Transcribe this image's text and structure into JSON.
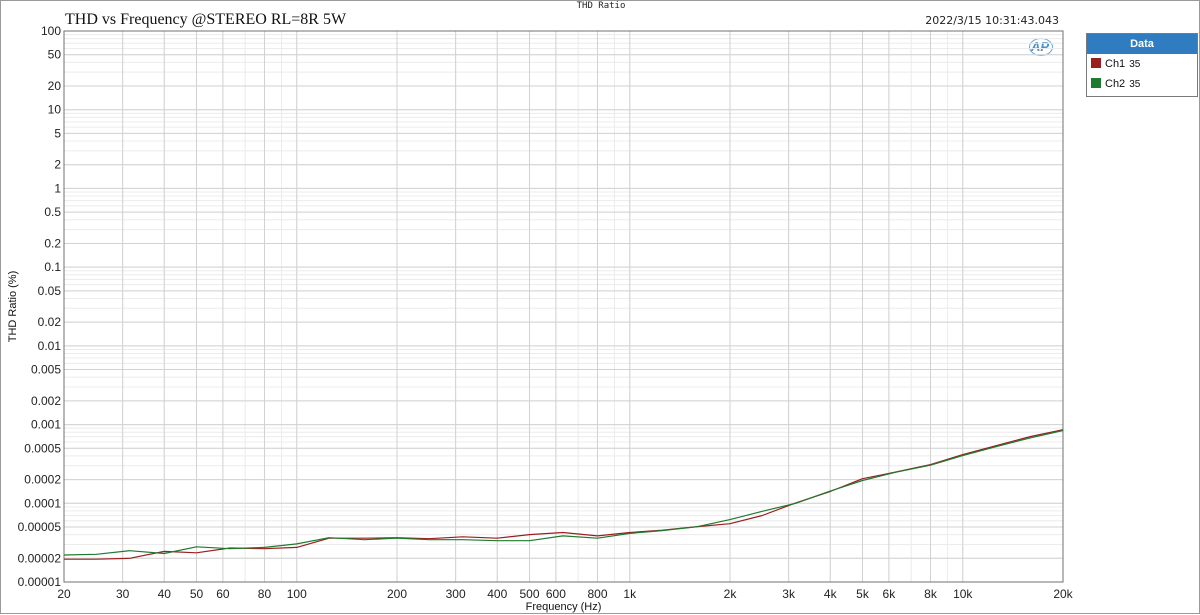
{
  "window_title": "THD Ratio",
  "timestamp": "2022/3/15 10:31:43.043",
  "logo": "AP",
  "legend": {
    "header": "Data",
    "entries": [
      {
        "name": "Ch1",
        "count": "35",
        "color": "#9a1f1f"
      },
      {
        "name": "Ch2",
        "count": "35",
        "color": "#1f7a2e"
      }
    ]
  },
  "chart_data": {
    "type": "line",
    "title": "THD vs Frequency @STEREO RL=8R 5W",
    "xlabel": "Frequency (Hz)",
    "ylabel": "THD Ratio (%)",
    "x_scale": "log",
    "y_scale": "log",
    "xlim": [
      20,
      20000
    ],
    "ylim": [
      1e-05,
      100
    ],
    "grid": true,
    "legend_position": "top-right outside",
    "x_ticks": [
      {
        "v": 20,
        "label": "20"
      },
      {
        "v": 30,
        "label": "30"
      },
      {
        "v": 40,
        "label": "40"
      },
      {
        "v": 50,
        "label": "50"
      },
      {
        "v": 60,
        "label": "60"
      },
      {
        "v": 80,
        "label": "80"
      },
      {
        "v": 100,
        "label": "100"
      },
      {
        "v": 200,
        "label": "200"
      },
      {
        "v": 300,
        "label": "300"
      },
      {
        "v": 400,
        "label": "400"
      },
      {
        "v": 500,
        "label": "500"
      },
      {
        "v": 600,
        "label": "600"
      },
      {
        "v": 800,
        "label": "800"
      },
      {
        "v": 1000,
        "label": "1k"
      },
      {
        "v": 2000,
        "label": "2k"
      },
      {
        "v": 3000,
        "label": "3k"
      },
      {
        "v": 4000,
        "label": "4k"
      },
      {
        "v": 5000,
        "label": "5k"
      },
      {
        "v": 6000,
        "label": "6k"
      },
      {
        "v": 8000,
        "label": "8k"
      },
      {
        "v": 10000,
        "label": "10k"
      },
      {
        "v": 20000,
        "label": "20k"
      }
    ],
    "y_ticks": [
      {
        "v": 100,
        "label": "100"
      },
      {
        "v": 50,
        "label": "50"
      },
      {
        "v": 20,
        "label": "20"
      },
      {
        "v": 10,
        "label": "10"
      },
      {
        "v": 5,
        "label": "5"
      },
      {
        "v": 2,
        "label": "2"
      },
      {
        "v": 1,
        "label": "1"
      },
      {
        "v": 0.5,
        "label": "0.5"
      },
      {
        "v": 0.2,
        "label": "0.2"
      },
      {
        "v": 0.1,
        "label": "0.1"
      },
      {
        "v": 0.05,
        "label": "0.05"
      },
      {
        "v": 0.02,
        "label": "0.02"
      },
      {
        "v": 0.01,
        "label": "0.01"
      },
      {
        "v": 0.005,
        "label": "0.005"
      },
      {
        "v": 0.002,
        "label": "0.002"
      },
      {
        "v": 0.001,
        "label": "0.001"
      },
      {
        "v": 0.0005,
        "label": "0.0005"
      },
      {
        "v": 0.0002,
        "label": "0.0002"
      },
      {
        "v": 0.0001,
        "label": "0.0001"
      },
      {
        "v": 5e-05,
        "label": "0.00005"
      },
      {
        "v": 2e-05,
        "label": "0.00002"
      },
      {
        "v": 1e-05,
        "label": "0.00001"
      }
    ],
    "series": [
      {
        "name": "Ch1",
        "color": "#9a1f1f",
        "points": [
          [
            20,
            1.95e-05
          ],
          [
            25,
            1.95e-05
          ],
          [
            31.5,
            2e-05
          ],
          [
            40,
            2.45e-05
          ],
          [
            50,
            2.35e-05
          ],
          [
            63,
            2.7e-05
          ],
          [
            80,
            2.65e-05
          ],
          [
            100,
            2.75e-05
          ],
          [
            125,
            3.6e-05
          ],
          [
            160,
            3.6e-05
          ],
          [
            200,
            3.65e-05
          ],
          [
            250,
            3.55e-05
          ],
          [
            315,
            3.75e-05
          ],
          [
            400,
            3.6e-05
          ],
          [
            500,
            4e-05
          ],
          [
            630,
            4.25e-05
          ],
          [
            800,
            3.85e-05
          ],
          [
            1000,
            4.25e-05
          ],
          [
            1250,
            4.55e-05
          ],
          [
            1600,
            5.05e-05
          ],
          [
            2000,
            5.5e-05
          ],
          [
            2500,
            7e-05
          ],
          [
            3150,
            0.000101
          ],
          [
            4000,
            0.000141
          ],
          [
            5000,
            0.000205
          ],
          [
            6300,
            0.00025
          ],
          [
            8000,
            0.00031
          ],
          [
            10000,
            0.000415
          ],
          [
            12500,
            0.000535
          ],
          [
            16000,
            0.000705
          ],
          [
            20000,
            0.00086
          ]
        ]
      },
      {
        "name": "Ch2",
        "color": "#1f7a2e",
        "points": [
          [
            20,
            2.2e-05
          ],
          [
            25,
            2.25e-05
          ],
          [
            31.5,
            2.5e-05
          ],
          [
            40,
            2.3e-05
          ],
          [
            50,
            2.8e-05
          ],
          [
            63,
            2.65e-05
          ],
          [
            80,
            2.75e-05
          ],
          [
            100,
            3.05e-05
          ],
          [
            125,
            3.65e-05
          ],
          [
            160,
            3.45e-05
          ],
          [
            200,
            3.6e-05
          ],
          [
            250,
            3.45e-05
          ],
          [
            315,
            3.45e-05
          ],
          [
            400,
            3.35e-05
          ],
          [
            500,
            3.35e-05
          ],
          [
            630,
            3.85e-05
          ],
          [
            800,
            3.6e-05
          ],
          [
            1000,
            4.15e-05
          ],
          [
            1250,
            4.5e-05
          ],
          [
            1600,
            5.05e-05
          ],
          [
            2000,
            6.2e-05
          ],
          [
            2500,
            7.9e-05
          ],
          [
            3150,
            0.0001
          ],
          [
            4000,
            0.000143
          ],
          [
            5000,
            0.000195
          ],
          [
            6300,
            0.000248
          ],
          [
            8000,
            0.000305
          ],
          [
            10000,
            0.000405
          ],
          [
            12500,
            0.00052
          ],
          [
            16000,
            0.00068
          ],
          [
            20000,
            0.00084
          ]
        ]
      }
    ]
  }
}
